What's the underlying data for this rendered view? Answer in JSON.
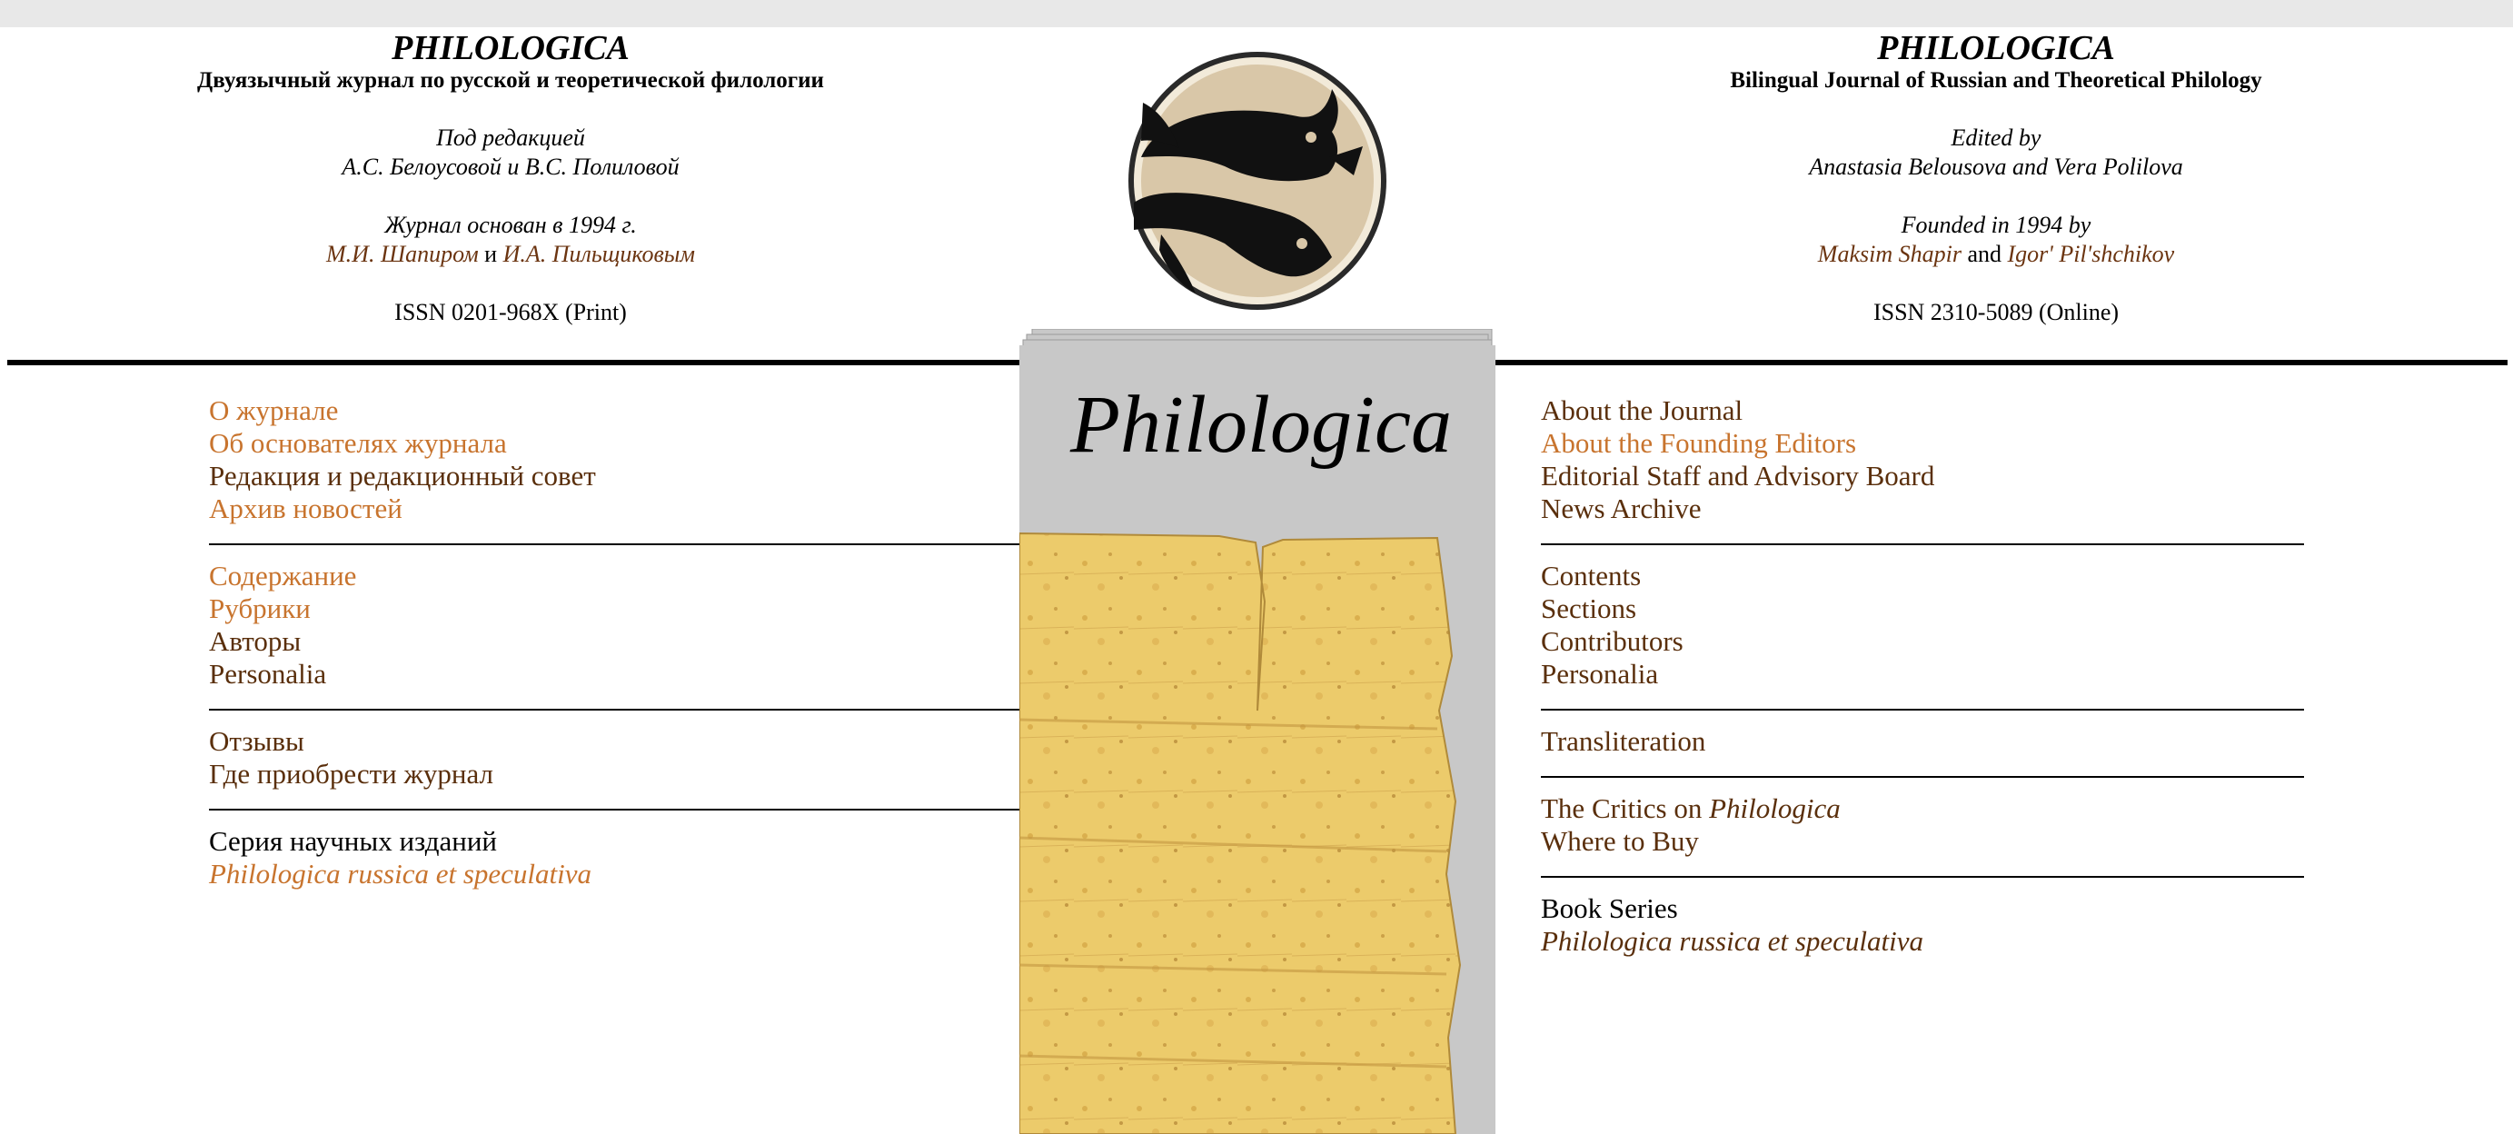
{
  "header_ru": {
    "title": "PHILOLOGICA",
    "subtitle": "Двуязычный журнал по русской и теоретической филологии",
    "edited_label": "Под редакцией",
    "editors": "А.С. Белоусовой и В.С. Полиловой",
    "founded_label": "Журнал основан в 1994 г.",
    "founder1": "М.И. Шапиром",
    "and_word": "и",
    "founder2": "И.А. Пильщиковым",
    "issn": "ISSN 0201-968X (Print)"
  },
  "header_en": {
    "title": "PHILOLOGICA",
    "subtitle": "Bilingual Journal of Russian and Theoretical Philology",
    "edited_label": "Edited by",
    "editors": "Anastasia Belousova and Vera Polilova",
    "founded_label": "Founded in 1994 by",
    "founder1": "Maksim Shapir",
    "and_word": "and",
    "founder2": "Igor' Pil'shchikov",
    "issn": "ISSN 2310-5089 (Online)"
  },
  "cover": {
    "title": "Philologica"
  },
  "nav_ru": {
    "group1": [
      "О журнале",
      "Об основателях журнала",
      "Редакция и редакционный совет",
      "Архив новостей"
    ],
    "group2": [
      "Содержание",
      "Рубрики",
      "Авторы",
      "Personalia"
    ],
    "group3": [
      "Отзывы",
      "Где приобрести журнал"
    ],
    "group4": [
      "Серия научных изданий",
      "Philologica russica et speculativa"
    ]
  },
  "nav_en": {
    "group1": [
      "About the Journal",
      "About the Founding Editors",
      "Editorial Staff and Advisory Board",
      "News Archive"
    ],
    "group2": [
      "Contents",
      "Sections",
      "Contributors",
      "Personalia"
    ],
    "group3": [
      "Transliteration"
    ],
    "critics_prefix": "The Critics on",
    "critics_title": "Philologica",
    "where_to_buy": "Where to Buy",
    "group5": [
      "Book Series",
      "Philologica russica et speculativa"
    ]
  },
  "colors": {
    "link_orange": "#c8742e",
    "link_dark": "#5a2f0c",
    "cover_grey": "#c8c8c8",
    "papyrus": "#e9c86a",
    "logo_bg": "#d9c7a8"
  }
}
